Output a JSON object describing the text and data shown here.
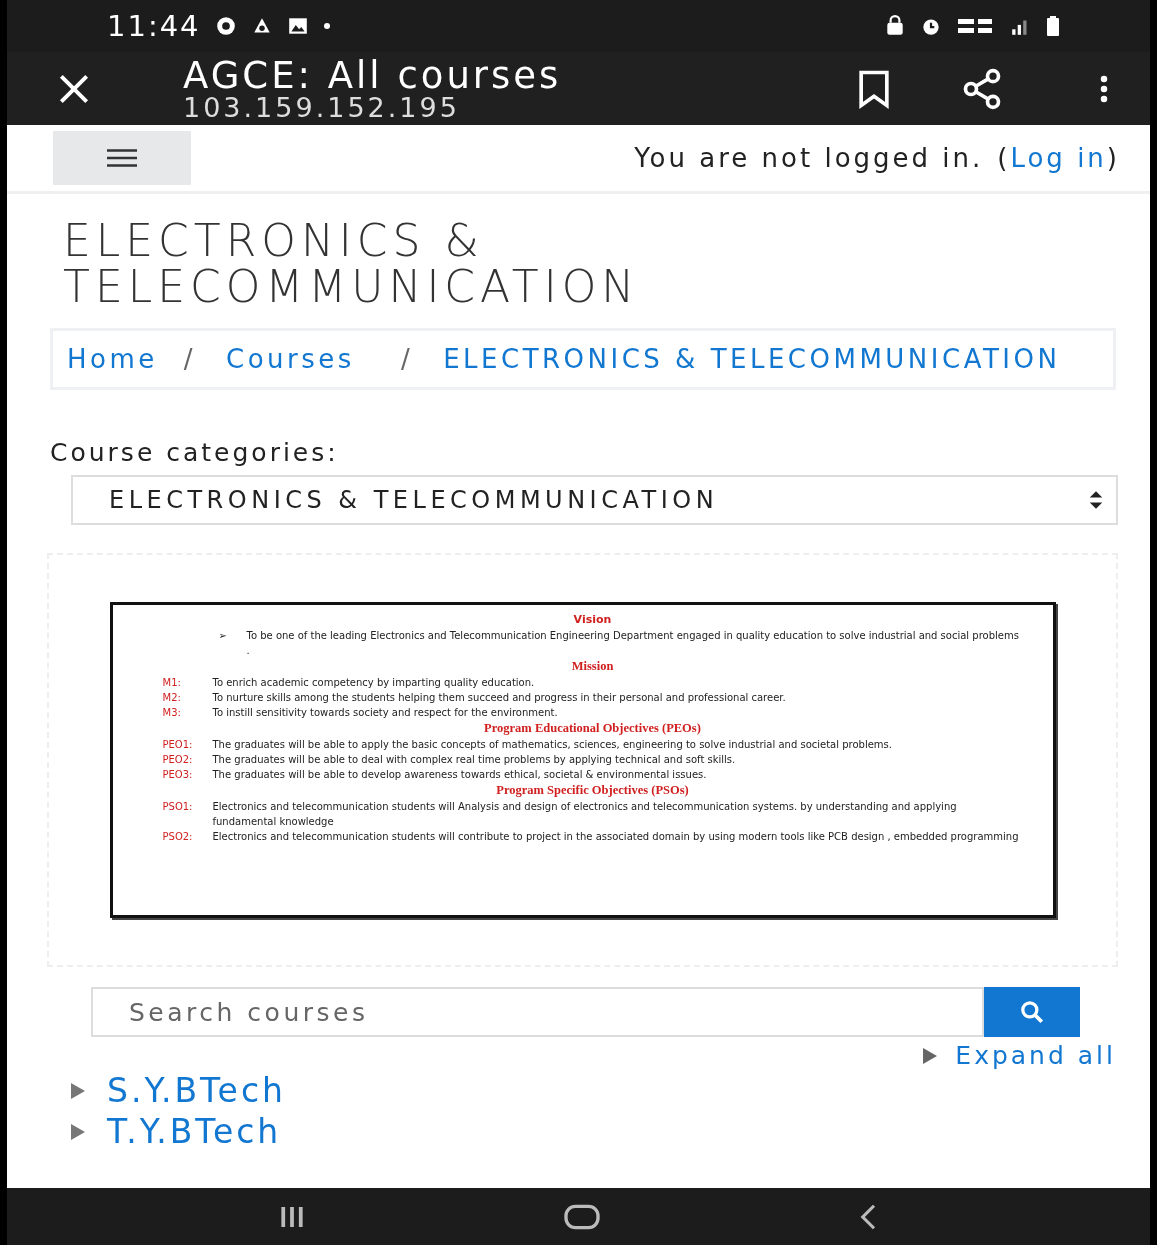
{
  "status_bar": {
    "time": "11:44"
  },
  "toolbar": {
    "title": "AGCE: All courses",
    "url": "103.159.152.195"
  },
  "navbar": {
    "login_text": "You are not logged in.",
    "login_open": "(",
    "login_link": "Log in",
    "login_close": ")"
  },
  "page_title": "ELECTRONICS & TELECOMMUNICATION",
  "breadcrumb": {
    "separator": "/",
    "items": [
      "Home",
      "Courses",
      "ELECTRONICS & TELECOMMUNICATION"
    ]
  },
  "category_label": "Course categories:",
  "category_select": {
    "value": "ELECTRONICS & TELECOMMUNICATION"
  },
  "document": {
    "sections": [
      {
        "heading": "Vision",
        "kind": "bullets",
        "items": [
          {
            "label": "➢",
            "text": "To be one of the leading Electronics and Telecommunication Engineering Department engaged in quality education to solve industrial and social problems ."
          }
        ]
      },
      {
        "heading": "Mission",
        "kind": "labeled",
        "items": [
          {
            "label": "M1:",
            "text": "To enrich academic competency by imparting quality education."
          },
          {
            "label": "M2:",
            "text": "To nurture skills among the students helping them succeed and progress in their personal and professional career."
          },
          {
            "label": "M3:",
            "text": "To instill sensitivity towards society and respect for the environment."
          }
        ]
      },
      {
        "heading": "Program Educational Objectives (PEOs)",
        "kind": "labeled",
        "items": [
          {
            "label": "PEO1:",
            "text": "The graduates will be able to apply the basic concepts of mathematics, sciences, engineering to solve industrial and societal problems."
          },
          {
            "label": "PEO2:",
            "text": "The graduates will be able to deal with complex real time problems by applying technical and soft skills."
          },
          {
            "label": "PEO3:",
            "text": "The graduates will be able to develop awareness towards ethical, societal & environmental issues."
          }
        ]
      },
      {
        "heading": "Program Specific Objectives (PSOs)",
        "kind": "labeled",
        "items": [
          {
            "label": "PSO1:",
            "text": "Electronics and telecommunication students will Analysis and design of electronics and telecommunication systems. by understanding and applying fundamental knowledge"
          },
          {
            "label": "PSO2:",
            "text": "Electronics and telecommunication students will contribute to project in the associated domain by using modern tools like PCB design , embedded programming"
          }
        ]
      }
    ]
  },
  "search": {
    "placeholder": "Search courses"
  },
  "expand_all": {
    "label": "Expand all",
    "expanded": false
  },
  "categories": [
    {
      "label": "S.Y.BTech",
      "expanded": false
    },
    {
      "label": "T.Y.BTech",
      "expanded": false
    }
  ]
}
